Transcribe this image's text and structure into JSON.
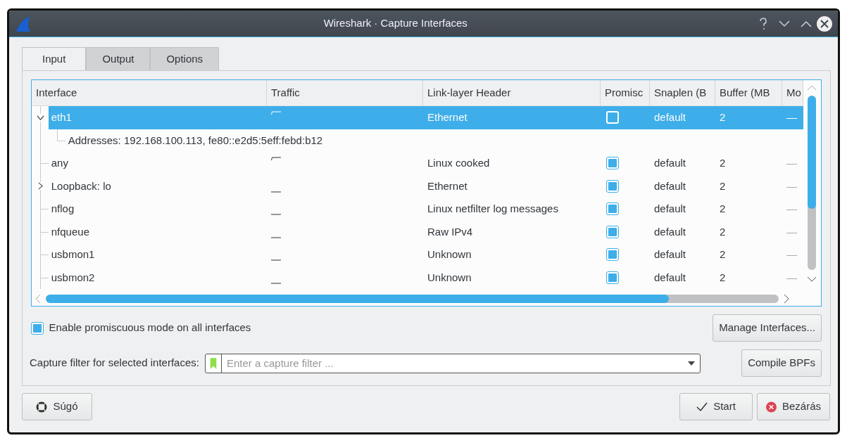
{
  "window": {
    "title": "Wireshark · Capture Interfaces"
  },
  "tabs": [
    {
      "label": "Input",
      "selected": true
    },
    {
      "label": "Output",
      "selected": false
    },
    {
      "label": "Options",
      "selected": false
    }
  ],
  "table": {
    "columns": [
      "Interface",
      "Traffic",
      "Link-layer Header",
      "Promisc",
      "Snaplen (B",
      "Buffer (MB",
      "Mo"
    ],
    "rows": [
      {
        "interface": "eth1",
        "expanded": true,
        "selected": true,
        "traffic_active": true,
        "link_layer_header": "Ethernet",
        "promisc_checked": false,
        "snaplen": "default",
        "buffer": "2",
        "column_7": "—",
        "children": [
          {
            "text": "Addresses: 192.168.100.113, fe80::e2d5:5eff:febd:b12"
          }
        ]
      },
      {
        "interface": "any",
        "selected": false,
        "traffic_active": true,
        "link_layer_header": "Linux cooked",
        "promisc_checked": true,
        "snaplen": "default",
        "buffer": "2",
        "column_7": "—"
      },
      {
        "interface": "Loopback: lo",
        "expanded": false,
        "selected": false,
        "traffic_active": false,
        "link_layer_header": "Ethernet",
        "promisc_checked": true,
        "snaplen": "default",
        "buffer": "2",
        "column_7": "—"
      },
      {
        "interface": "nflog",
        "selected": false,
        "traffic_active": false,
        "link_layer_header": "Linux netfilter log messages",
        "promisc_checked": true,
        "snaplen": "default",
        "buffer": "2",
        "column_7": "—"
      },
      {
        "interface": "nfqueue",
        "selected": false,
        "traffic_active": false,
        "link_layer_header": "Raw IPv4",
        "promisc_checked": true,
        "snaplen": "default",
        "buffer": "2",
        "column_7": "—"
      },
      {
        "interface": "usbmon1",
        "selected": false,
        "traffic_active": false,
        "link_layer_header": "Unknown",
        "promisc_checked": true,
        "snaplen": "default",
        "buffer": "2",
        "column_7": "—"
      },
      {
        "interface": "usbmon2",
        "selected": false,
        "traffic_active": false,
        "link_layer_header": "Unknown",
        "promisc_checked": true,
        "snaplen": "default",
        "buffer": "2",
        "column_7": "—"
      }
    ]
  },
  "promiscuous_all": {
    "label": "Enable promiscuous mode on all interfaces",
    "checked": true
  },
  "manage_button": "Manage Interfaces...",
  "capture_filter": {
    "label": "Capture filter for selected interfaces:",
    "placeholder": "Enter a capture filter ..."
  },
  "compile_button": "Compile BPFs",
  "buttons": [
    {
      "label": "Súgó",
      "kind": "help"
    },
    {
      "label": "Start",
      "kind": "start"
    },
    {
      "label": "Bezárás",
      "kind": "close"
    }
  ]
}
